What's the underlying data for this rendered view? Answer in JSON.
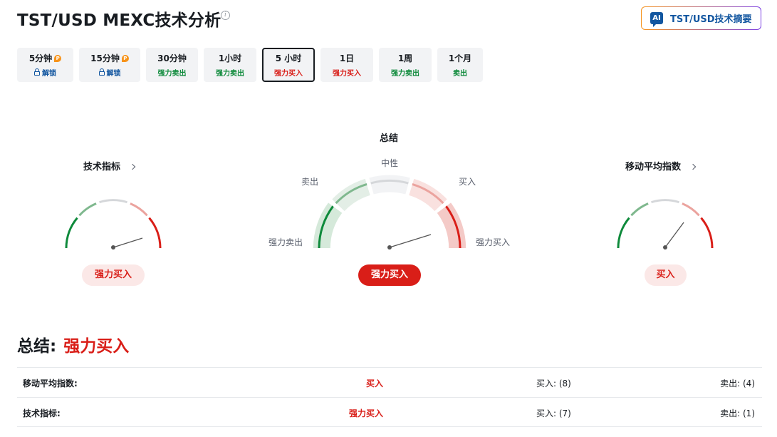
{
  "header": {
    "title": "TST/USD MEXC技术分析",
    "ai_badge": "AI",
    "ai_button_label": "TST/USD技术摘要"
  },
  "tabs": [
    {
      "label": "5分钟",
      "status": "解锁",
      "kind": "unlock",
      "pro": true
    },
    {
      "label": "15分钟",
      "status": "解锁",
      "kind": "unlock",
      "pro": true
    },
    {
      "label": "30分钟",
      "status": "强力卖出",
      "kind": "sell"
    },
    {
      "label": "1小时",
      "status": "强力卖出",
      "kind": "sell"
    },
    {
      "label": "5 小时",
      "status": "强力买入",
      "kind": "buy",
      "active": true
    },
    {
      "label": "1日",
      "status": "强力买入",
      "kind": "buy"
    },
    {
      "label": "1周",
      "status": "强力卖出",
      "kind": "sell"
    },
    {
      "label": "1个月",
      "status": "卖出",
      "kind": "sell"
    }
  ],
  "gauges": {
    "technical": {
      "title": "技术指标",
      "result": "强力买入"
    },
    "summary": {
      "title": "总结",
      "result": "强力买入",
      "labels": {
        "neutral": "中性",
        "sell": "卖出",
        "buy": "买入",
        "strong_sell": "强力卖出",
        "strong_buy": "强力买入"
      }
    },
    "moving_averages": {
      "title": "移动平均指数",
      "result": "买入"
    }
  },
  "summary": {
    "heading": "总结:",
    "value": "强力买入",
    "rows": [
      {
        "label": "移动平均指数:",
        "signal": "买入",
        "buy": "买入: (8)",
        "sell": "卖出: (4)"
      },
      {
        "label": "技术指标:",
        "signal": "强力买入",
        "buy": "买入: (7)",
        "sell": "卖出: (1)"
      }
    ]
  },
  "colors": {
    "strong_sell": "#0e8a3b",
    "sell": "#7fb88e",
    "neutral": "#d5d7da",
    "buy": "#eba39e",
    "strong_buy": "#d91e18"
  }
}
